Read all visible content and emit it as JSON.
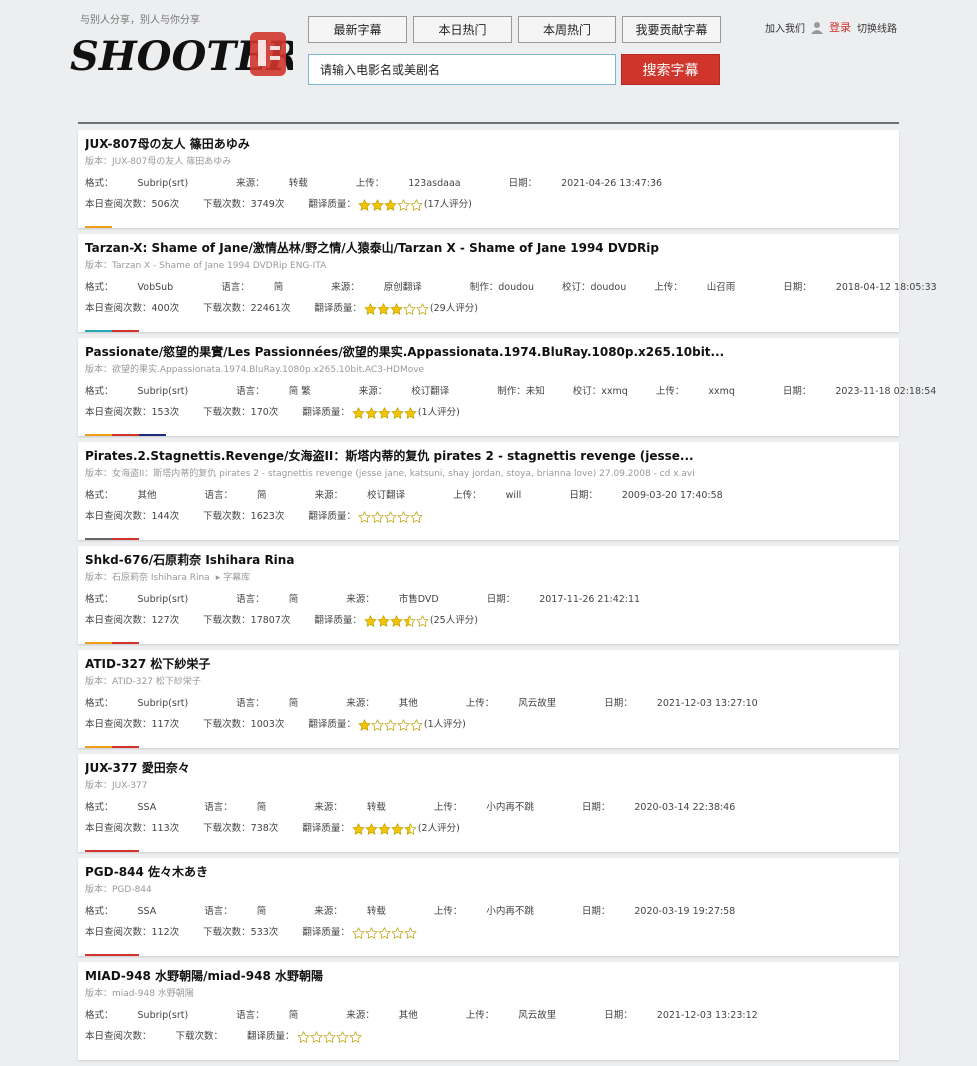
{
  "header": {
    "slogan": "与别人分享，别人与你分享",
    "logo_text": "SHOOTER",
    "nav": [
      "最新字幕",
      "本日热门",
      "本周热门",
      "我要贡献字幕"
    ],
    "search_placeholder": "请输入电影名或美剧名",
    "search_button": "搜索字幕",
    "join": "加入我们",
    "login": "登录",
    "switch": "切换线路"
  },
  "labels": {
    "format": "格式：",
    "lang": "语言：",
    "source": "来源：",
    "maker": "制作：",
    "proof": "校订：",
    "uploader": "上传：",
    "date": "日期：",
    "today_views": "本日查阅次数：",
    "downloads": "下载次数：",
    "quality": "翻译质量："
  },
  "colors": {
    "accent_red": "#d0352c",
    "orange": "#f0a020",
    "teal": "#2aa7b5",
    "navy": "#1c2b7a",
    "gray": "#666666"
  },
  "items": [
    {
      "title": "JUX-807母の友人 篠田あゆみ",
      "version": "版本：JUX-807母の友人 篠田あゆみ",
      "format": "Subrip(srt)",
      "source": "转载",
      "uploader": "123asdaaa",
      "date": "2021-04-26 13:47:36",
      "views": "506次",
      "downloads": "3749次",
      "stars": 3,
      "rating_count": "(17人评分)",
      "strip": [
        "#f0a020"
      ]
    },
    {
      "title": "Tarzan-X: Shame of Jane/激情丛林/野之情/人猿泰山/Tarzan X - Shame of Jane 1994 DVDRip",
      "version": "版本：Tarzan X - Shame of Jane 1994 DVDRip ENG-ITA",
      "format": "VobSub",
      "lang": "简",
      "source": "原创翻译",
      "maker": "doudou",
      "proof": "doudou",
      "uploader": "山召雨",
      "date": "2018-04-12 18:05:33",
      "views": "400次",
      "downloads": "22461次",
      "stars": 3,
      "rating_count": "(29人评分)",
      "strip": [
        "#2aa7b5",
        "#d0352c"
      ]
    },
    {
      "title": "Passionate/慾望的果實/Les Passionnées/欲望的果实.Appassionata.1974.BluRay.1080p.x265.10bit...",
      "version": "版本：欲望的果实.Appassionata.1974.BluRay.1080p.x265.10bit.AC3-HDMove",
      "format": "Subrip(srt)",
      "lang": "简 繁",
      "source": "校订翻译",
      "maker": "未知",
      "proof": "xxmq",
      "uploader": "xxmq",
      "date": "2023-11-18 02:18:54",
      "views": "153次",
      "downloads": "170次",
      "stars": 5,
      "rating_count": "(1人评分)",
      "strip": [
        "#f0a020",
        "#d0352c",
        "#1c2b7a"
      ]
    },
    {
      "title": "Pirates.2.Stagnettis.Revenge/女海盗II：斯塔内蒂的复仇 pirates 2 - stagnettis revenge (jesse...",
      "version": "版本：女海盗II：斯塔内蒂的复仇 pirates 2 - stagnettis revenge (jesse jane, katsuni, shay jordan, stoya, brianna love) 27.09.2008 - cd x.avi",
      "format": "其他",
      "lang": "简",
      "source": "校订翻译",
      "uploader": "will",
      "date": "2009-03-20 17:40:58",
      "views": "144次",
      "downloads": "1623次",
      "stars": 0,
      "rating_count": "",
      "strip": [
        "#666666",
        "#d0352c"
      ]
    },
    {
      "title": "Shkd-676/石原莉奈 Ishihara Rina",
      "version": "版本：石原莉奈 Ishihara Rina",
      "version_src": "字幕库",
      "format": "Subrip(srt)",
      "lang": "简",
      "source": "市售DVD",
      "date": "2017-11-26 21:42:11",
      "views": "127次",
      "downloads": "17807次",
      "stars": 3.5,
      "rating_count": "(25人评分)",
      "strip": [
        "#f0a020",
        "#d0352c"
      ]
    },
    {
      "title": "ATID-327 松下紗栄子",
      "version": "版本：ATID-327 松下紗栄子",
      "format": "Subrip(srt)",
      "lang": "简",
      "source": "其他",
      "uploader": "风云故里",
      "date": "2021-12-03 13:27:10",
      "views": "117次",
      "downloads": "1003次",
      "stars": 1,
      "rating_count": "(1人评分)",
      "strip": [
        "#f0a020",
        "#d0352c"
      ]
    },
    {
      "title": "JUX-377 愛田奈々",
      "version": "版本：JUX-377",
      "format": "SSA",
      "lang": "简",
      "source": "转载",
      "uploader": "小内再不跳",
      "date": "2020-03-14 22:38:46",
      "views": "113次",
      "downloads": "738次",
      "stars": 4.5,
      "rating_count": "(2人评分)",
      "strip": [
        "#d0352c",
        "#d0352c"
      ]
    },
    {
      "title": "PGD-844 佐々木あき",
      "version": "版本：PGD-844",
      "format": "SSA",
      "lang": "简",
      "source": "转载",
      "uploader": "小内再不跳",
      "date": "2020-03-19 19:27:58",
      "views": "112次",
      "downloads": "533次",
      "stars": 0,
      "rating_count": "",
      "strip": [
        "#d0352c",
        "#d0352c"
      ]
    },
    {
      "title": "MIAD-948 水野朝陽/miad-948 水野朝陽",
      "version": "版本：miad-948 水野朝陽",
      "format": "Subrip(srt)",
      "lang": "简",
      "source": "其他",
      "uploader": "风云故里",
      "date": "2021-12-03 13:23:12",
      "views": "",
      "downloads": "",
      "stars": 0,
      "rating_count": "",
      "strip": []
    }
  ]
}
